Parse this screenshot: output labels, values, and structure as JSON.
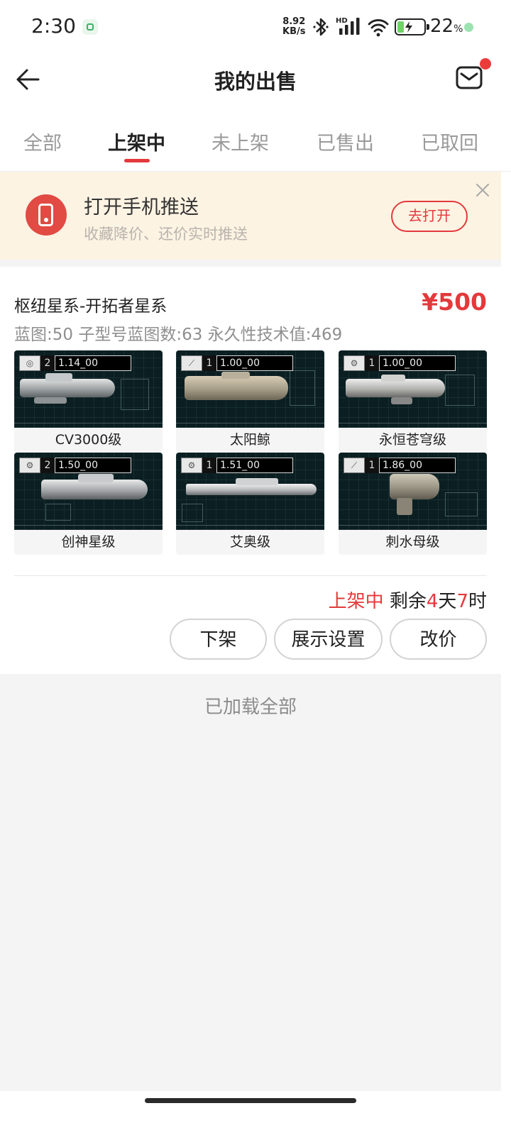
{
  "status_bar": {
    "time": "2:30",
    "net_speed_value": "8.92",
    "net_speed_unit": "KB/s",
    "hd_label": "HD",
    "battery_percent": "22",
    "battery_percent_unit": "%",
    "battery_level": 0.22,
    "icons": [
      "app-notification-icon",
      "bluetooth-icon",
      "signal-icon",
      "wifi-icon",
      "battery-charging-icon"
    ]
  },
  "header": {
    "title": "我的出售",
    "back_icon": "back-arrow-icon",
    "mail_icon": "mail-icon",
    "has_unread": true
  },
  "tabs": [
    {
      "label": "全部",
      "active": false
    },
    {
      "label": "上架中",
      "active": true
    },
    {
      "label": "未上架",
      "active": false
    },
    {
      "label": "已售出",
      "active": false
    },
    {
      "label": "已取回",
      "active": false
    }
  ],
  "push_banner": {
    "icon": "phone-icon",
    "title": "打开手机推送",
    "subtitle": "收藏降价、还价实时推送",
    "button_label": "去打开",
    "close_icon": "close-icon"
  },
  "listing": {
    "title": "枢纽星系-开拓者星系",
    "price": "¥500",
    "specs": "蓝图:50 子型号蓝图数:63 永久性技术值:469",
    "ships": [
      {
        "name": "CV3000级",
        "count": "2",
        "level": "1.14_00",
        "badge_icon": "faction-emblem-icon"
      },
      {
        "name": "太阳鲸",
        "count": "1",
        "level": "1.00_00",
        "badge_icon": "faction-wing-icon"
      },
      {
        "name": "永恒苍穹级",
        "count": "1",
        "level": "1.00_00",
        "badge_icon": "faction-gear-icon"
      },
      {
        "name": "创神星级",
        "count": "2",
        "level": "1.50_00",
        "badge_icon": "faction-gear-icon"
      },
      {
        "name": "艾奥级",
        "count": "1",
        "level": "1.51_00",
        "badge_icon": "faction-gear-icon"
      },
      {
        "name": "刺水母级",
        "count": "1",
        "level": "1.86_00",
        "badge_icon": "faction-wing-icon"
      }
    ],
    "status_label": "上架中",
    "remaining_prefix": "剩余",
    "remaining_days": "4",
    "days_unit": "天",
    "remaining_hours": "7",
    "hours_unit": "时",
    "buttons": {
      "delist": "下架",
      "display_settings": "展示设置",
      "change_price": "改价"
    }
  },
  "footer_text": "已加载全部",
  "colors": {
    "accent_red": "#e4393c",
    "banner_bg": "#fdf3e3",
    "page_bg": "#f4f4f4",
    "ship_bg": "#0b1f22"
  }
}
